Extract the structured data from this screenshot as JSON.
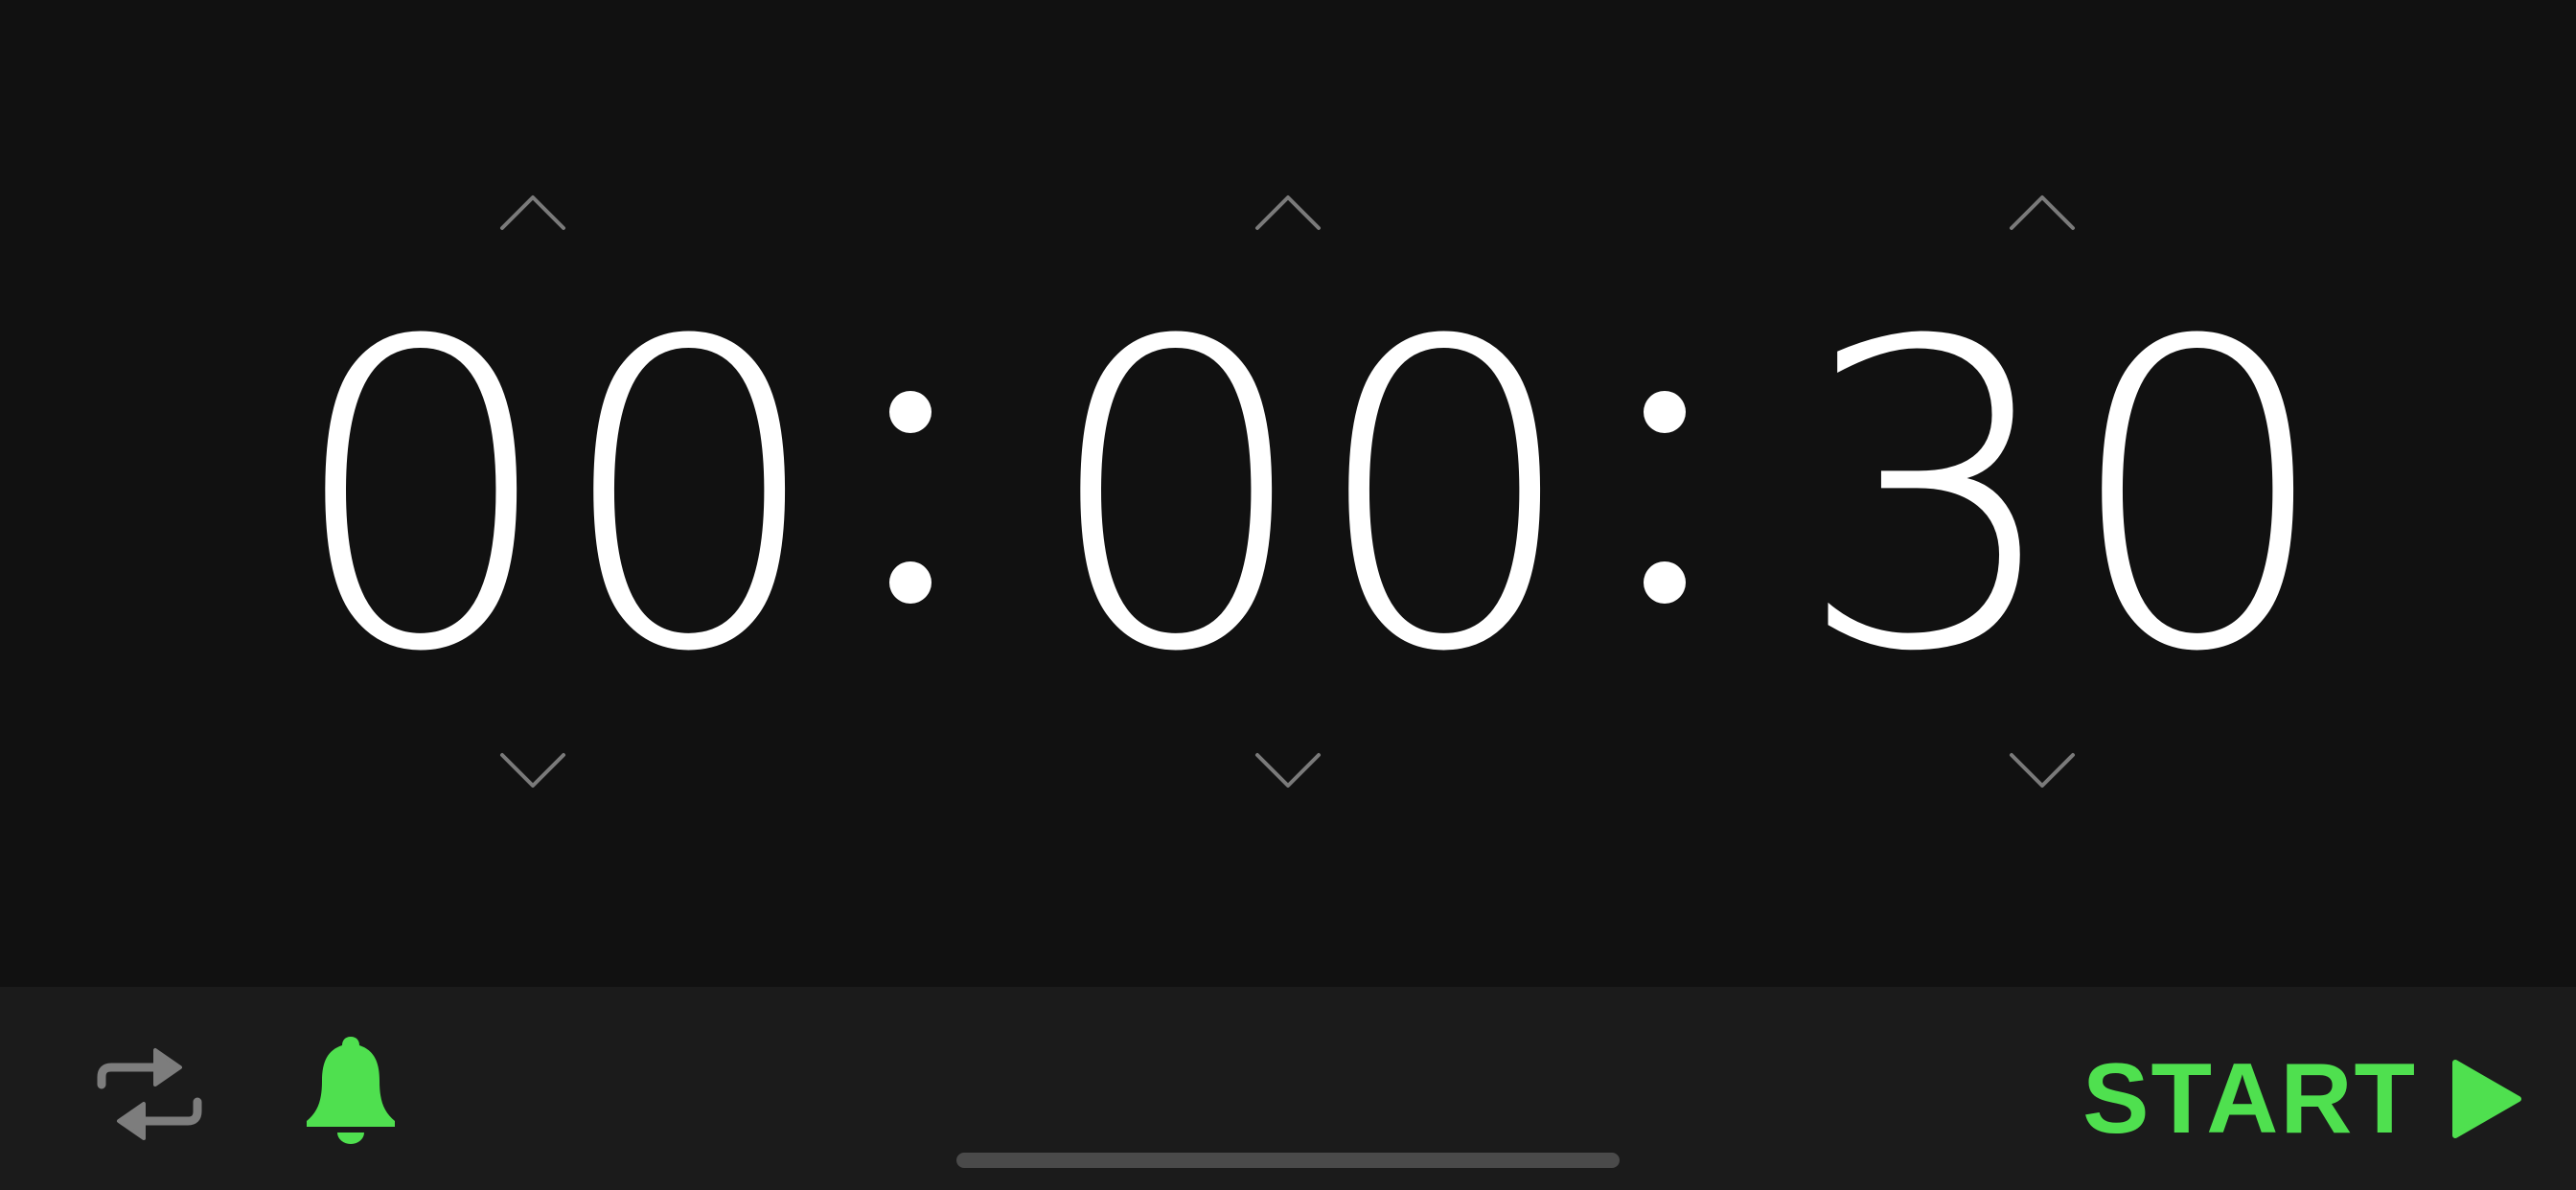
{
  "timer": {
    "hours": "00",
    "minutes": "00",
    "seconds": "30"
  },
  "toolbar": {
    "start_label": "START",
    "repeat_icon": "repeat-icon",
    "bell_icon": "bell-icon",
    "play_icon": "play-icon"
  },
  "colors": {
    "background": "#111111",
    "toolbar_background": "#1b1b1b",
    "accent": "#4fe04f",
    "digits": "#ffffff",
    "chevron": "#7a7a7a"
  }
}
